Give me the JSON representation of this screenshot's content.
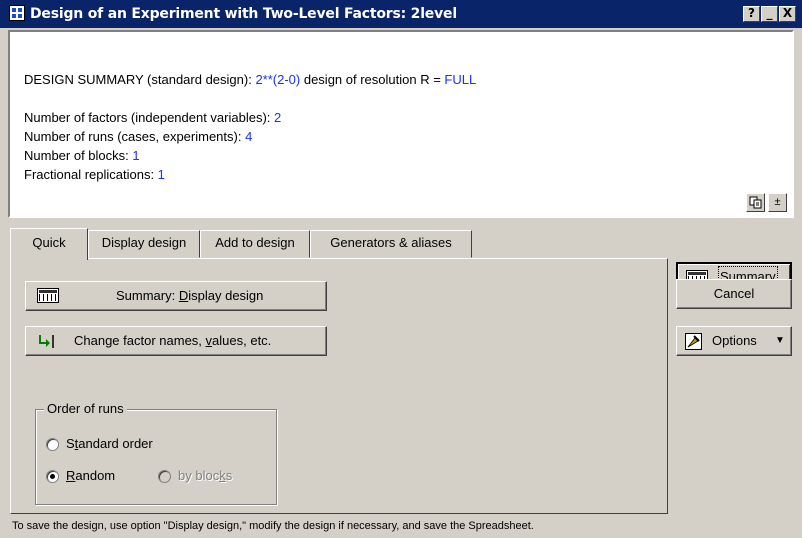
{
  "window": {
    "title": "Design of an Experiment with Two-Level Factors: 2level",
    "help_label": "?",
    "minimize_label": "_",
    "close_label": "X"
  },
  "summary": {
    "design_prefix": "DESIGN SUMMARY (standard design): ",
    "design_value": "2**(2-0)",
    "design_middle": " design of resolution R = ",
    "resolution_value": "FULL",
    "factors_label": "Number of factors (independent variables): ",
    "factors_value": "2",
    "runs_label": "Number of runs (cases, experiments): ",
    "runs_value": "4",
    "blocks_label": "Number of blocks: ",
    "blocks_value": "1",
    "fractional_label": "Fractional replications: ",
    "fractional_value": "1",
    "expand_label": "±"
  },
  "tabs": [
    {
      "label": "Quick"
    },
    {
      "label": "Display design"
    },
    {
      "label": "Add to design"
    },
    {
      "label": "Generators & aliases"
    }
  ],
  "quick": {
    "summary_btn_pre": "Summary:  ",
    "summary_btn_u": "D",
    "summary_btn_post": "isplay design",
    "change_btn_pre": "Change factor names, ",
    "change_btn_u": "v",
    "change_btn_post": "alues, etc.",
    "order_group_label": "Order of runs",
    "standard_pre": "S",
    "standard_u": "t",
    "standard_post": "andard order",
    "random_u": "R",
    "random_post": "andom",
    "blocks_pre": "by bloc",
    "blocks_u": "k",
    "blocks_post": "s"
  },
  "right_buttons": {
    "summary_label": "Summary",
    "cancel_label": "Cancel",
    "options_label": "Options",
    "options_arrow": "▼"
  },
  "footer": "To save the design, use option \"Display design,\" modify the design if necessary, and save the Spreadsheet."
}
